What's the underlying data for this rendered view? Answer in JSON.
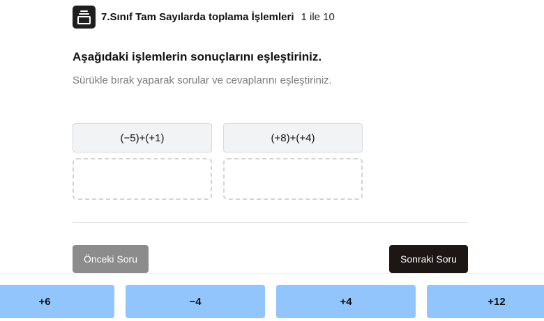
{
  "header": {
    "icon": "stack-icon",
    "title": "7.Sınıf Tam Sayılarda toplama İşlemleri",
    "progress": "1 ile 10"
  },
  "question": {
    "prompt": "Aşağıdaki işlemlerin sonuçlarını eşleştiriniz.",
    "hint": "Sürükle bırak yaparak sorular ve cevaplarını eşleştiriniz."
  },
  "pairs": [
    {
      "expression": "(−5)+(+1)"
    },
    {
      "expression": "(+8)+(+4)"
    }
  ],
  "nav": {
    "prev_label": "Önceki Soru",
    "next_label": "Sonraki Soru"
  },
  "answers": [
    "+6",
    "−4",
    "+4",
    "+12"
  ],
  "colors": {
    "answer_chip": "#93c5fd",
    "next_button": "#1c1714",
    "prev_button": "#8c8c8c"
  }
}
